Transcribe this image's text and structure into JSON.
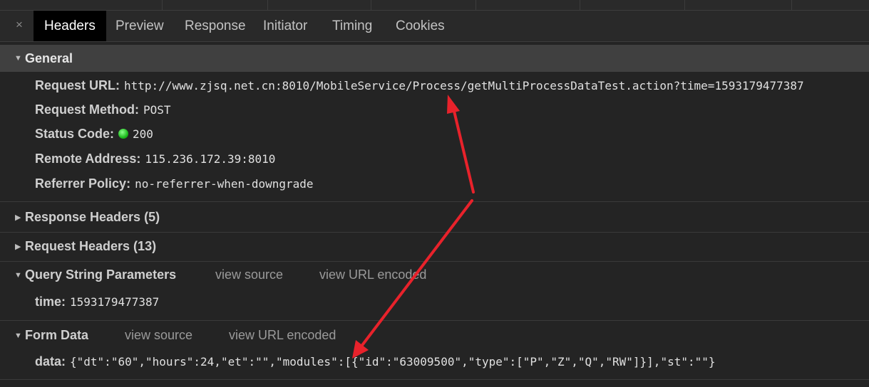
{
  "tabs": [
    {
      "label": "Headers"
    },
    {
      "label": "Preview"
    },
    {
      "label": "Response"
    },
    {
      "label": "Initiator"
    },
    {
      "label": "Timing"
    },
    {
      "label": "Cookies"
    }
  ],
  "close_glyph": "×",
  "general": {
    "title": "General",
    "request_url": {
      "key": "Request URL:",
      "value": "http://www.zjsq.net.cn:8010/MobileService/Process/getMultiProcessDataTest.action?time=1593179477387"
    },
    "request_method": {
      "key": "Request Method:",
      "value": "POST"
    },
    "status_code": {
      "key": "Status Code:",
      "value": "200",
      "dot_color": "#22c322"
    },
    "remote_address": {
      "key": "Remote Address:",
      "value": "115.236.172.39:8010"
    },
    "referrer_policy": {
      "key": "Referrer Policy:",
      "value": "no-referrer-when-downgrade"
    }
  },
  "response_headers": {
    "title": "Response Headers (5)"
  },
  "request_headers": {
    "title": "Request Headers (13)"
  },
  "query_string": {
    "title": "Query String Parameters",
    "view_source": "view source",
    "view_url_encoded": "view URL encoded",
    "param": {
      "key": "time:",
      "value": "1593179477387"
    }
  },
  "form_data": {
    "title": "Form Data",
    "view_source": "view source",
    "view_url_encoded": "view URL encoded",
    "param": {
      "key": "data:",
      "value": "{\"dt\":\"60\",\"hours\":24,\"et\":\"\",\"modules\":[{\"id\":\"63009500\",\"type\":[\"P\",\"Z\",\"Q\",\"RW\"]}],\"st\":\"\"}"
    }
  },
  "annotation": {
    "arrow_color": "#e8222b"
  }
}
